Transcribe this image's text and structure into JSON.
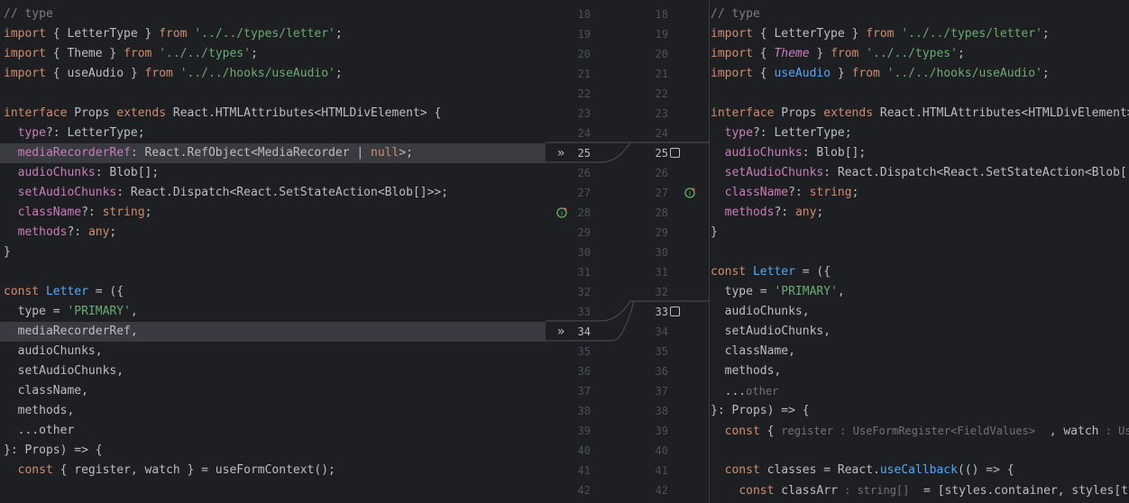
{
  "left": {
    "lines": [
      {
        "tokens": [
          {
            "t": "// type",
            "c": "comment"
          }
        ]
      },
      {
        "tokens": [
          {
            "t": "import",
            "c": "keyword"
          },
          {
            "t": " { LetterType } ",
            "c": "text"
          },
          {
            "t": "from",
            "c": "keyword"
          },
          {
            "t": " ",
            "c": "text"
          },
          {
            "t": "'../../types/letter'",
            "c": "string"
          },
          {
            "t": ";",
            "c": "text"
          }
        ]
      },
      {
        "tokens": [
          {
            "t": "import",
            "c": "keyword"
          },
          {
            "t": " { Theme } ",
            "c": "text"
          },
          {
            "t": "from",
            "c": "keyword"
          },
          {
            "t": " ",
            "c": "text"
          },
          {
            "t": "'../../types'",
            "c": "string"
          },
          {
            "t": ";",
            "c": "text"
          }
        ]
      },
      {
        "tokens": [
          {
            "t": "import",
            "c": "keyword"
          },
          {
            "t": " { useAudio } ",
            "c": "text"
          },
          {
            "t": "from",
            "c": "keyword"
          },
          {
            "t": " ",
            "c": "text"
          },
          {
            "t": "'../../hooks/useAudio'",
            "c": "string"
          },
          {
            "t": ";",
            "c": "text"
          }
        ]
      },
      {
        "tokens": []
      },
      {
        "tokens": [
          {
            "t": "interface",
            "c": "keyword"
          },
          {
            "t": " Props ",
            "c": "text"
          },
          {
            "t": "extends",
            "c": "keyword"
          },
          {
            "t": " React.HTMLAttributes<HTMLDivElement> {",
            "c": "text"
          }
        ]
      },
      {
        "tokens": [
          {
            "t": "  ",
            "c": "text"
          },
          {
            "t": "type",
            "c": "field"
          },
          {
            "t": "?: LetterType;",
            "c": "text"
          }
        ]
      },
      {
        "changed": true,
        "tokens": [
          {
            "t": "  ",
            "c": "text"
          },
          {
            "t": "mediaRecorderRef",
            "c": "field"
          },
          {
            "t": ": React.RefObject<MediaRecorder | ",
            "c": "text"
          },
          {
            "t": "null",
            "c": "keyword"
          },
          {
            "t": ">;",
            "c": "text"
          }
        ]
      },
      {
        "tokens": [
          {
            "t": "  ",
            "c": "text"
          },
          {
            "t": "audioChunks",
            "c": "field"
          },
          {
            "t": ": Blob[];",
            "c": "text"
          }
        ]
      },
      {
        "tokens": [
          {
            "t": "  ",
            "c": "text"
          },
          {
            "t": "setAudioChunks",
            "c": "field"
          },
          {
            "t": ": React.Dispatch<React.SetStateAction<Blob[]>>;",
            "c": "text"
          }
        ]
      },
      {
        "tokens": [
          {
            "t": "  ",
            "c": "text"
          },
          {
            "t": "className",
            "c": "field"
          },
          {
            "t": "?: ",
            "c": "text"
          },
          {
            "t": "string",
            "c": "keyword"
          },
          {
            "t": ";",
            "c": "text"
          }
        ]
      },
      {
        "tokens": [
          {
            "t": "  ",
            "c": "text"
          },
          {
            "t": "methods",
            "c": "field"
          },
          {
            "t": "?: ",
            "c": "text"
          },
          {
            "t": "any",
            "c": "keyword"
          },
          {
            "t": ";",
            "c": "text"
          }
        ]
      },
      {
        "tokens": [
          {
            "t": "}",
            "c": "text"
          }
        ]
      },
      {
        "tokens": []
      },
      {
        "tokens": [
          {
            "t": "const",
            "c": "keyword"
          },
          {
            "t": " ",
            "c": "text"
          },
          {
            "t": "Letter",
            "c": "func"
          },
          {
            "t": " = ({",
            "c": "text"
          }
        ]
      },
      {
        "tokens": [
          {
            "t": "  type = ",
            "c": "text"
          },
          {
            "t": "'PRIMARY'",
            "c": "string"
          },
          {
            "t": ",",
            "c": "text"
          }
        ]
      },
      {
        "changed": true,
        "tokens": [
          {
            "t": "  mediaRecorderRef,",
            "c": "text"
          }
        ]
      },
      {
        "tokens": [
          {
            "t": "  audioChunks,",
            "c": "text"
          }
        ]
      },
      {
        "tokens": [
          {
            "t": "  setAudioChunks,",
            "c": "text"
          }
        ]
      },
      {
        "tokens": [
          {
            "t": "  className,",
            "c": "text"
          }
        ]
      },
      {
        "tokens": [
          {
            "t": "  methods,",
            "c": "text"
          }
        ]
      },
      {
        "tokens": [
          {
            "t": "  ...other",
            "c": "text"
          }
        ]
      },
      {
        "tokens": [
          {
            "t": "}: Props) => {",
            "c": "text"
          }
        ]
      },
      {
        "tokens": [
          {
            "t": "  ",
            "c": "text"
          },
          {
            "t": "const",
            "c": "keyword"
          },
          {
            "t": " { register, watch } = useFormContext();",
            "c": "text"
          }
        ]
      }
    ]
  },
  "right": {
    "lines": [
      {
        "tokens": [
          {
            "t": "// type",
            "c": "comment"
          }
        ]
      },
      {
        "tokens": [
          {
            "t": "import",
            "c": "keyword"
          },
          {
            "t": " { LetterType } ",
            "c": "text"
          },
          {
            "t": "from",
            "c": "keyword"
          },
          {
            "t": " ",
            "c": "text"
          },
          {
            "t": "'../../types/letter'",
            "c": "string"
          },
          {
            "t": ";",
            "c": "text"
          }
        ]
      },
      {
        "tokens": [
          {
            "t": "import",
            "c": "keyword"
          },
          {
            "t": " { ",
            "c": "text"
          },
          {
            "t": "Theme",
            "c": "italic"
          },
          {
            "t": " } ",
            "c": "text"
          },
          {
            "t": "from",
            "c": "keyword"
          },
          {
            "t": " ",
            "c": "text"
          },
          {
            "t": "'../../types'",
            "c": "string"
          },
          {
            "t": ";",
            "c": "text"
          }
        ]
      },
      {
        "tokens": [
          {
            "t": "import",
            "c": "keyword"
          },
          {
            "t": " { ",
            "c": "text"
          },
          {
            "t": "useAudio",
            "c": "func"
          },
          {
            "t": " } ",
            "c": "text"
          },
          {
            "t": "from",
            "c": "keyword"
          },
          {
            "t": " ",
            "c": "text"
          },
          {
            "t": "'../../hooks/useAudio'",
            "c": "string"
          },
          {
            "t": ";",
            "c": "text"
          }
        ]
      },
      {
        "tokens": []
      },
      {
        "tokens": [
          {
            "t": "interface",
            "c": "keyword"
          },
          {
            "t": " Props ",
            "c": "text"
          },
          {
            "t": "extends",
            "c": "keyword"
          },
          {
            "t": " React.HTMLAttributes<HTMLDivElement>",
            "c": "text"
          }
        ]
      },
      {
        "tokens": [
          {
            "t": "  ",
            "c": "text"
          },
          {
            "t": "type",
            "c": "field"
          },
          {
            "t": "?: LetterType;",
            "c": "text"
          }
        ]
      },
      {
        "tokens": [
          {
            "t": "  ",
            "c": "text"
          },
          {
            "t": "audioChunks",
            "c": "field"
          },
          {
            "t": ": Blob[];",
            "c": "text"
          }
        ]
      },
      {
        "tokens": [
          {
            "t": "  ",
            "c": "text"
          },
          {
            "t": "setAudioChunks",
            "c": "field"
          },
          {
            "t": ": React.Dispatch<React.SetStateAction<Blob[]",
            "c": "text"
          }
        ]
      },
      {
        "tokens": [
          {
            "t": "  ",
            "c": "text"
          },
          {
            "t": "className",
            "c": "field"
          },
          {
            "t": "?: ",
            "c": "text"
          },
          {
            "t": "string",
            "c": "keyword"
          },
          {
            "t": ";",
            "c": "text"
          }
        ]
      },
      {
        "tokens": [
          {
            "t": "  ",
            "c": "text"
          },
          {
            "t": "methods",
            "c": "field"
          },
          {
            "t": "?: ",
            "c": "text"
          },
          {
            "t": "any",
            "c": "keyword"
          },
          {
            "t": ";",
            "c": "text"
          }
        ]
      },
      {
        "tokens": [
          {
            "t": "}",
            "c": "text"
          }
        ]
      },
      {
        "tokens": []
      },
      {
        "tokens": [
          {
            "t": "const",
            "c": "keyword"
          },
          {
            "t": " ",
            "c": "text"
          },
          {
            "t": "Letter",
            "c": "func"
          },
          {
            "t": " = ({",
            "c": "text"
          }
        ]
      },
      {
        "tokens": [
          {
            "t": "  type = ",
            "c": "text"
          },
          {
            "t": "'PRIMARY'",
            "c": "string"
          },
          {
            "t": ",",
            "c": "text"
          }
        ]
      },
      {
        "tokens": [
          {
            "t": "  audioChunks,",
            "c": "text"
          }
        ]
      },
      {
        "tokens": [
          {
            "t": "  setAudioChunks,",
            "c": "text"
          }
        ]
      },
      {
        "tokens": [
          {
            "t": "  className,",
            "c": "text"
          }
        ]
      },
      {
        "tokens": [
          {
            "t": "  methods,",
            "c": "text"
          }
        ]
      },
      {
        "tokens": [
          {
            "t": "  ...",
            "c": "text"
          },
          {
            "t": "other",
            "c": "hint"
          }
        ]
      },
      {
        "tokens": [
          {
            "t": "}: Props) => {",
            "c": "text"
          }
        ]
      },
      {
        "tokens": [
          {
            "t": "  ",
            "c": "text"
          },
          {
            "t": "const",
            "c": "keyword"
          },
          {
            "t": " { ",
            "c": "text"
          },
          {
            "t": "register",
            "c": "hint"
          },
          {
            "t": " : UseFormRegister<FieldValues>",
            "c": "hint"
          },
          {
            "t": "  , ",
            "c": "text"
          },
          {
            "t": "watch",
            "c": "text"
          },
          {
            "t": " : UseForm",
            "c": "hint"
          }
        ]
      },
      {
        "tokens": []
      },
      {
        "tokens": [
          {
            "t": "  ",
            "c": "text"
          },
          {
            "t": "const",
            "c": "keyword"
          },
          {
            "t": " classes = React.",
            "c": "text"
          },
          {
            "t": "useCallback",
            "c": "func"
          },
          {
            "t": "(() => {",
            "c": "text"
          }
        ]
      },
      {
        "tokens": [
          {
            "t": "    ",
            "c": "text"
          },
          {
            "t": "const",
            "c": "keyword"
          },
          {
            "t": " classArr",
            "c": "text"
          },
          {
            "t": " : string[]",
            "c": "hint"
          },
          {
            "t": "  = [styles.container, styles[type",
            "c": "text"
          }
        ]
      }
    ]
  },
  "gutter": {
    "left_numbers": [
      "18",
      "19",
      "20",
      "21",
      "22",
      "23",
      "24",
      "25",
      "26",
      "27",
      "28",
      "29",
      "30",
      "31",
      "32",
      "33",
      "34",
      "35",
      "36",
      "37",
      "38",
      "39",
      "40",
      "41",
      "42"
    ],
    "right_numbers": [
      "18",
      "19",
      "20",
      "21",
      "22",
      "23",
      "24",
      "25",
      "26",
      "27",
      "28",
      "29",
      "30",
      "31",
      "32",
      "33",
      "34",
      "35",
      "36",
      "37",
      "38",
      "39",
      "40",
      "41",
      "42"
    ],
    "arrow_glyph": "»"
  },
  "colors": {
    "background": "#1e1f22",
    "changed_line": "#393b40",
    "keyword": "#cf8e6d",
    "string": "#6aab73",
    "field": "#c77dbb",
    "function": "#56a8f5",
    "comment": "#7a7e85"
  }
}
